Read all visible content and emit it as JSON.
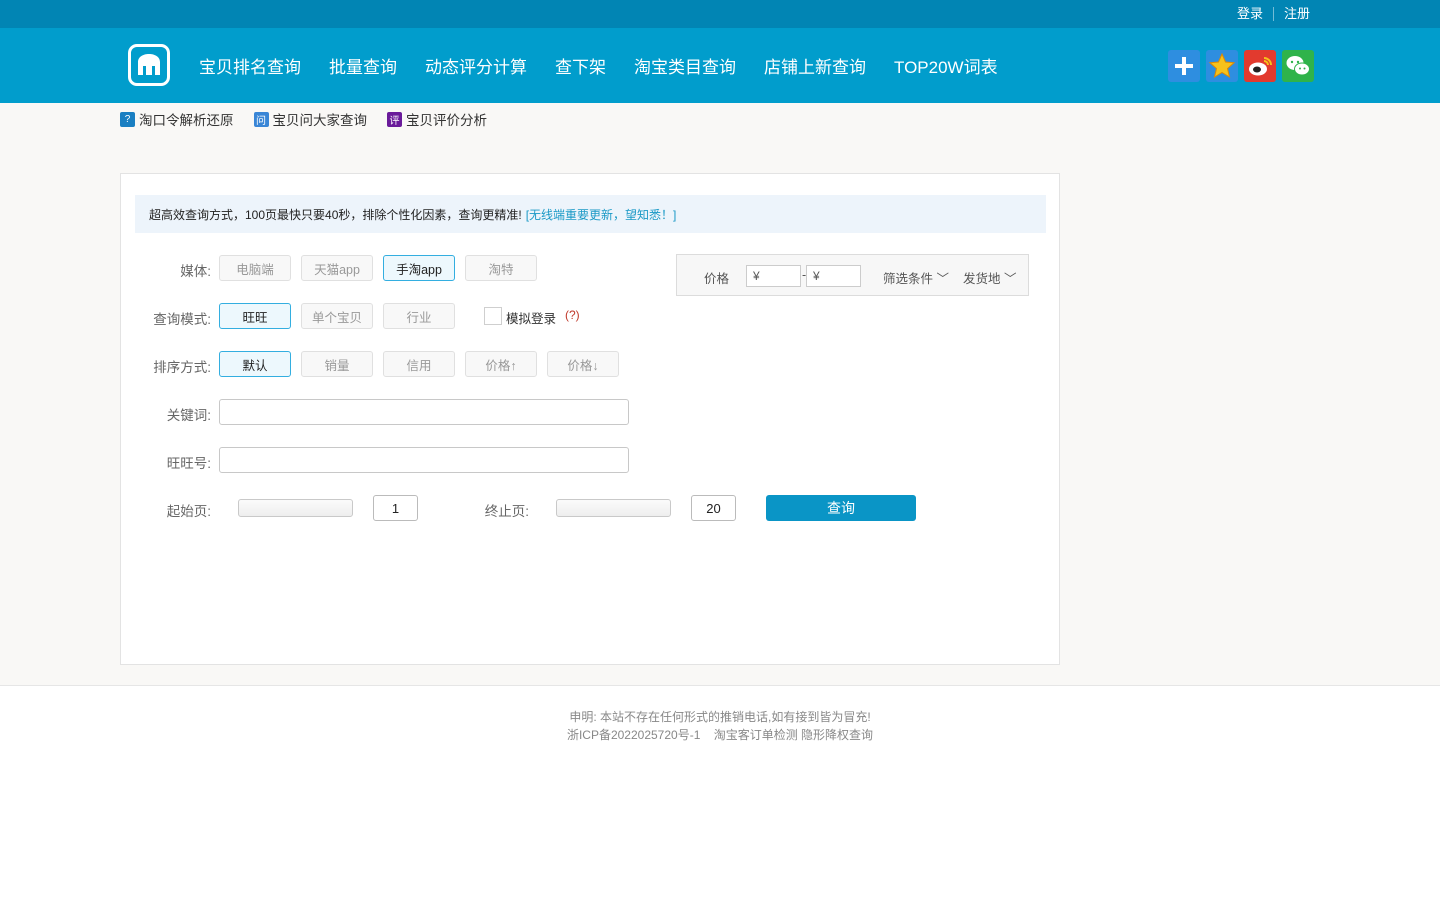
{
  "topbar": {
    "login": "登录",
    "register": "注册"
  },
  "nav": [
    "宝贝排名查询",
    "批量查询",
    "动态评分计算",
    "查下架",
    "淘宝类目查询",
    "店铺上新查询",
    "TOP20W词表"
  ],
  "subnav": [
    {
      "icon": "?",
      "label": "淘口令解析还原",
      "color": "#1a7fc2"
    },
    {
      "icon": "问",
      "label": "宝贝问大家查询",
      "color": "#3a86d6"
    },
    {
      "icon": "评",
      "label": "宝贝评价分析",
      "color": "#6a1b9a"
    }
  ],
  "notice": {
    "text": "超高效查询方式，100页最快只要40秒，排除个性化因素，查询更精准!",
    "link": "[无线端重要更新，望知悉！]"
  },
  "media": {
    "label": "媒体:",
    "options": [
      "电脑端",
      "天猫app",
      "手淘app",
      "淘特"
    ],
    "selected": "手淘app"
  },
  "mode": {
    "label": "查询模式:",
    "options": [
      "旺旺",
      "单个宝贝",
      "行业"
    ],
    "selected": "旺旺",
    "simulate_label": "模拟登录",
    "help": "(?)"
  },
  "sort": {
    "label": "排序方式:",
    "options": [
      "默认",
      "销量",
      "信用",
      "价格↑",
      "价格↓"
    ],
    "selected": "默认"
  },
  "keyword": {
    "label": "关键词:",
    "value": ""
  },
  "wangwang": {
    "label": "旺旺号:",
    "value": ""
  },
  "pages": {
    "start_label": "起始页:",
    "start_value": "1",
    "end_label": "终止页:",
    "end_value": "20",
    "query_button": "查询"
  },
  "filter": {
    "price_label": "价格",
    "price_min": "¥",
    "dash": "-",
    "price_max": "¥",
    "filter_label": "筛选条件",
    "ship_label": "发货地"
  },
  "footer": {
    "line1": "申明: 本站不存在任何形式的推销电话,如有接到皆为冒充!",
    "line2": "浙ICP备2022025720号-1    淘宝客订单检测 隐形降权查询"
  },
  "colors": {
    "topbar": "#0185b4",
    "header": "#019dcc",
    "button": "#0a95c6"
  }
}
